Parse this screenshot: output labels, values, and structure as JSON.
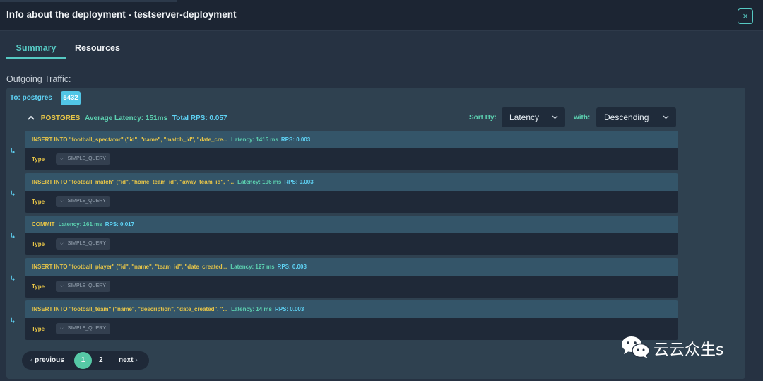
{
  "header": {
    "title": "Info about the deployment - testserver-deployment",
    "close_label": "×"
  },
  "tabs": [
    {
      "label": "Summary",
      "active": true
    },
    {
      "label": "Resources",
      "active": false
    }
  ],
  "section_label": "Outgoing Traffic:",
  "target": {
    "label": "To: postgres",
    "port": "5432"
  },
  "group": {
    "name": "POSTGRES",
    "avg_latency": "Average Latency: 151ms",
    "total_rps": "Total RPS: 0.057"
  },
  "sort": {
    "label": "Sort By:",
    "value": "Latency",
    "with_label": "with:",
    "with_value": "Descending"
  },
  "queries": [
    {
      "text": "INSERT INTO \"football_spectator\" (\"id\", \"name\", \"match_id\", \"date_cre...",
      "latency": "Latency: 1415 ms",
      "rps": "RPS: 0.003",
      "type_label": "Type",
      "type_value": "SIMPLE_QUERY"
    },
    {
      "text": "INSERT INTO \"football_match\" (\"id\", \"home_team_id\", \"away_team_id\", \"...",
      "latency": "Latency: 196 ms",
      "rps": "RPS: 0.003",
      "type_label": "Type",
      "type_value": "SIMPLE_QUERY"
    },
    {
      "text": "COMMIT",
      "latency": "Latency: 161 ms",
      "rps": "RPS: 0.017",
      "type_label": "Type",
      "type_value": "SIMPLE_QUERY"
    },
    {
      "text": "INSERT INTO \"football_player\" (\"id\", \"name\", \"team_id\", \"date_created...",
      "latency": "Latency: 127 ms",
      "rps": "RPS: 0.003",
      "type_label": "Type",
      "type_value": "SIMPLE_QUERY"
    },
    {
      "text": "INSERT INTO \"football_team\" (\"name\", \"description\", \"date_created\", \"...",
      "latency": "Latency: 14 ms",
      "rps": "RPS: 0.003",
      "type_label": "Type",
      "type_value": "SIMPLE_QUERY"
    }
  ],
  "pagination": {
    "previous": "previous",
    "pages": [
      "1",
      "2"
    ],
    "current": "1",
    "next": "next"
  },
  "watermark": {
    "text": "云云众生s",
    "icon": "wechat-icon"
  },
  "colors": {
    "accent": "#56c9c3",
    "query_text": "#e7c548",
    "latency": "#5cd0b0",
    "rps": "#5fd3f5",
    "badge": "#51c6e6"
  }
}
